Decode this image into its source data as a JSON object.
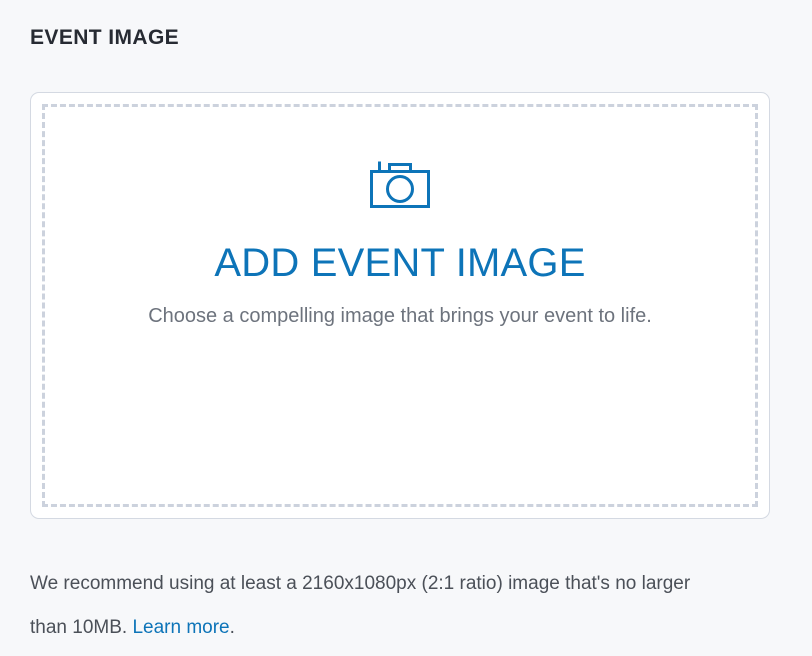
{
  "section": {
    "title": "EVENT IMAGE"
  },
  "upload": {
    "icon": "camera-icon",
    "title": "ADD EVENT IMAGE",
    "subtitle": "Choose a compelling image that brings your event to life."
  },
  "helper": {
    "text_before_link": "We recommend using at least a 2160x1080px (2:1 ratio) image that's no larger than 10MB. ",
    "link_label": "Learn more",
    "text_after_link": "."
  },
  "colors": {
    "page_background": "#f7f8fa",
    "card_background": "#ffffff",
    "card_border": "#d4d9e2",
    "dropzone_dash": "#ccd2dd",
    "accent_blue": "#0d74b8",
    "heading_text": "#272b33",
    "muted_text": "#6d737d",
    "helper_text": "#4b5058"
  }
}
